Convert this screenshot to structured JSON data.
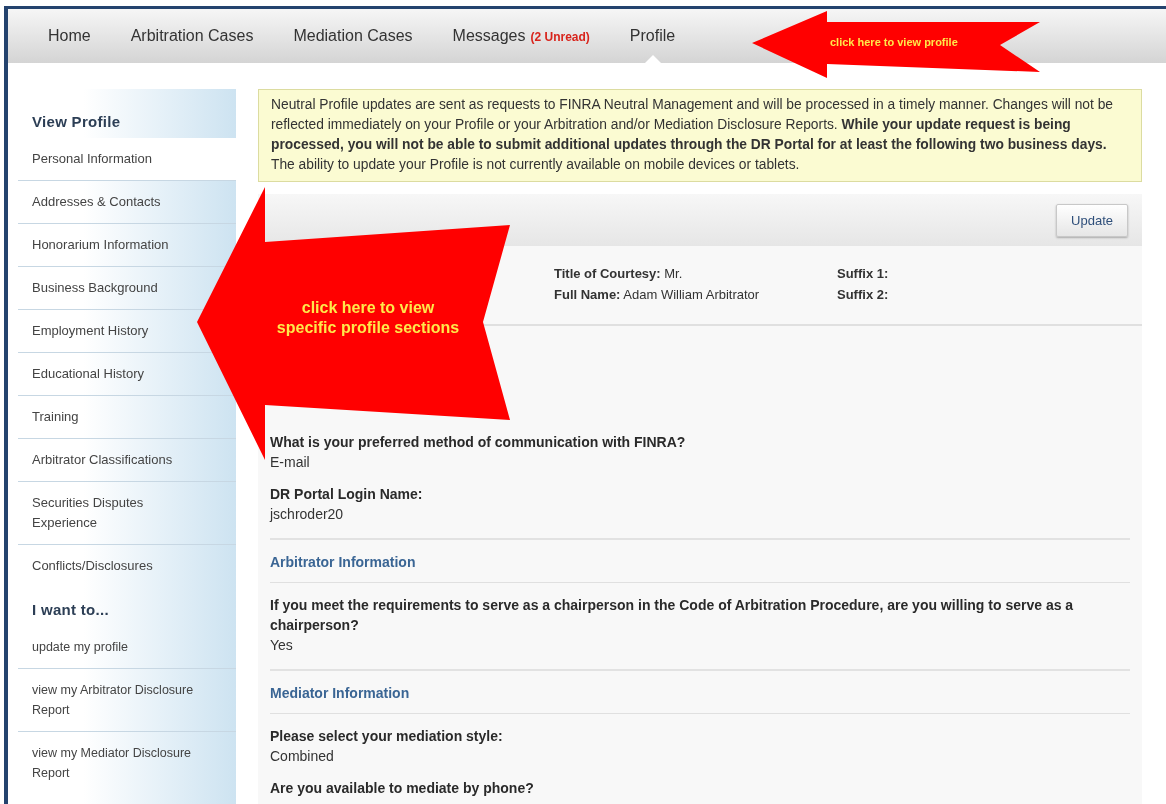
{
  "nav": {
    "tabs": [
      {
        "label": "Home",
        "selected": false
      },
      {
        "label": "Arbitration Cases",
        "selected": false
      },
      {
        "label": "Mediation Cases",
        "selected": false
      },
      {
        "label": "Messages",
        "badge": "(2 Unread)",
        "selected": false
      },
      {
        "label": "Profile",
        "selected": true
      }
    ]
  },
  "sidebar": {
    "sections": [
      {
        "heading": "View Profile",
        "items": [
          {
            "label": "Personal Information",
            "selected": true
          },
          {
            "label": "Addresses & Contacts",
            "selected": false
          },
          {
            "label": "Honorarium Information",
            "selected": false
          },
          {
            "label": "Business Background",
            "selected": false
          },
          {
            "label": "Employment History",
            "selected": false
          },
          {
            "label": "Educational History",
            "selected": false
          },
          {
            "label": "Training",
            "selected": false
          },
          {
            "label": "Arbitrator Classifications",
            "selected": false
          },
          {
            "label": "Securities Disputes Experience",
            "selected": false
          },
          {
            "label": "Conflicts/Disclosures",
            "selected": false
          }
        ]
      },
      {
        "heading": "I want to...",
        "items": [
          {
            "label": "update my profile",
            "selected": false
          },
          {
            "label": "view my Arbitrator Disclosure Report",
            "selected": false
          },
          {
            "label": "view my Mediator Disclosure Report",
            "selected": false
          }
        ]
      }
    ]
  },
  "notice": {
    "text": "Neutral Profile updates are sent as requests to FINRA Neutral Management and will be processed in a timely manner. Changes will not be reflected immediately on your Profile or your Arbitration and/or Mediation Disclosure Reports. **While your update request is being processed, you will not be able to submit additional updates through the DR Portal for at least the following two business days.**",
    "note": "The ability to update your Profile is not currently available on mobile devices or tablets."
  },
  "toolbar": {
    "button": "Update"
  },
  "name_panel": {
    "fields": [
      {
        "label": "Title of Courtesy:",
        "value": "Mr."
      },
      {
        "label": "Suffix 1:"
      },
      {
        "label": "Full Name:",
        "value": "Adam William Arbitrator"
      },
      {
        "label": "Suffix 2:"
      }
    ]
  },
  "sections": [
    {
      "items": [
        {
          "question": "What is your preferred method of communication with FINRA?",
          "answer": "E-mail"
        },
        {
          "question": "DR Portal Login Name:",
          "answer": "jschroder20"
        }
      ]
    },
    {
      "heading": "Arbitrator Information",
      "items": [
        {
          "question": "If you meet the requirements to serve as a chairperson in the Code of Arbitration Procedure, are you willing to serve as a chairperson?",
          "answer": "Yes"
        }
      ]
    },
    {
      "heading": "Mediator Information",
      "items": [
        {
          "question": "Please select your mediation style:",
          "answer": "Combined"
        },
        {
          "question": "Are you available to mediate by phone?"
        }
      ]
    }
  ],
  "callouts": [
    {
      "kind": "small",
      "lines": [
        "click here to view profile"
      ]
    },
    {
      "kind": "large",
      "lines": [
        "click here to view",
        "specific profile sections"
      ]
    }
  ]
}
